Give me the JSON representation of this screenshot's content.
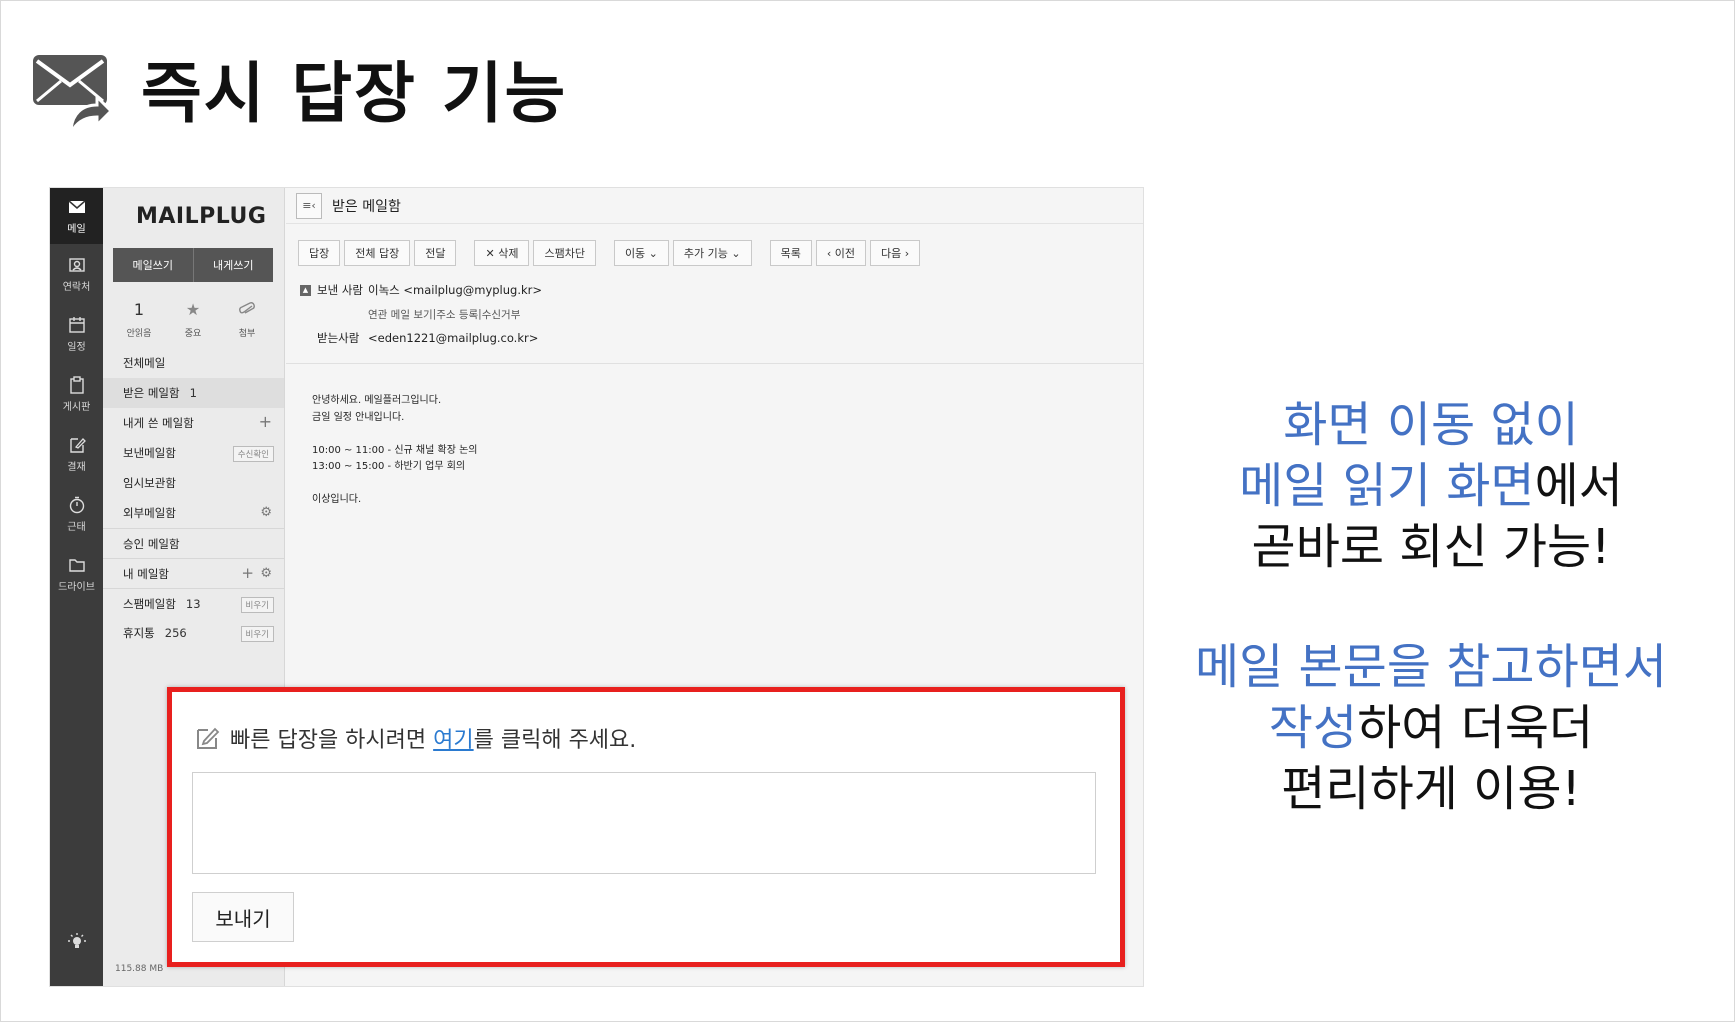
{
  "slide": {
    "title": "즉시 답장 기능",
    "message1": {
      "line1": "화면 이동 없이",
      "line2_highlight": "메일 읽기 화면",
      "line2_rest": "에서",
      "line3": "곧바로 회신 가능!"
    },
    "message2": {
      "line1": "메일 본문을 참고하면서",
      "line2_highlight": "작성",
      "line2_rest": "하여 더욱더",
      "line3": "편리하게 이용!"
    },
    "colors": {
      "highlight": "#4472c4",
      "frame": "#e8201e"
    }
  },
  "rail": [
    {
      "label": "메일",
      "icon": "mail-icon"
    },
    {
      "label": "연락처",
      "icon": "contacts-icon"
    },
    {
      "label": "일정",
      "icon": "calendar-icon"
    },
    {
      "label": "게시판",
      "icon": "clipboard-icon"
    },
    {
      "label": "결재",
      "icon": "edit-icon"
    },
    {
      "label": "근태",
      "icon": "timer-icon"
    },
    {
      "label": "드라이브",
      "icon": "folder-icon"
    }
  ],
  "app": {
    "logo": "MAILPLUG",
    "compose": "메일쓰기",
    "self_compose": "내게쓰기",
    "quick": [
      {
        "value": "1",
        "label": "안읽음"
      },
      {
        "label": "중요",
        "icon": "star-icon"
      },
      {
        "label": "첨부",
        "icon": "paperclip-icon"
      }
    ],
    "folders": [
      {
        "name": "전체메일"
      },
      {
        "name": "받은 메일함",
        "count": "1"
      },
      {
        "name": "내게 쓴 메일함"
      },
      {
        "name": "보낸메일함",
        "tag": "수신확인"
      },
      {
        "name": "임시보관함"
      },
      {
        "name": "외부메일함"
      },
      {
        "name": "승인 메일함"
      },
      {
        "name": "내 메일함"
      },
      {
        "name": "스팸메일함",
        "count": "13",
        "tag": "비우기"
      },
      {
        "name": "휴지통",
        "count": "256",
        "tag": "비우기"
      }
    ],
    "storage": "115.88 MB"
  },
  "mail": {
    "mailbox_title": "받은 메일함",
    "toolbar": {
      "reply": "답장",
      "reply_all": "전체 답장",
      "forward": "전달",
      "delete": "✕ 삭제",
      "block_spam": "스팸차단",
      "move": "이동 ⌄",
      "more": "추가 기능 ⌄",
      "list": "목록",
      "prev": "‹ 이전",
      "next": "다음 ›"
    },
    "sender_label": "보낸 사람",
    "sender": "이녹스 <mailplug@myplug.kr>",
    "links": [
      "연관 메일 보기",
      "주소 등록",
      "수신거부"
    ],
    "recipient_label": "받는사람",
    "recipient": "<eden1221@mailplug.co.kr>",
    "body": [
      "안녕하세요. 메일플러그입니다.",
      "금일 일정 안내입니다.",
      "",
      "10:00 ~ 11:00 - 신규 채널 확장 논의",
      "13:00 ~ 15:00 - 하반기 업무 회의",
      "",
      "이상입니다."
    ]
  },
  "quick_reply": {
    "prompt_before": "빠른 답장을 하시려면 ",
    "prompt_link": "여기",
    "prompt_after": "를 클릭해 주세요.",
    "send": "보내기"
  }
}
